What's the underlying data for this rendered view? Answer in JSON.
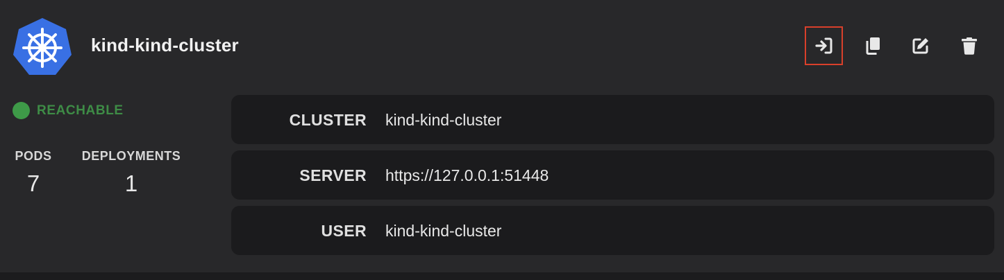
{
  "header": {
    "cluster_name": "kind-kind-cluster",
    "logo_icon": "kubernetes-helm-icon",
    "actions": [
      {
        "name": "connect",
        "icon": "sign-in-icon"
      },
      {
        "name": "copy",
        "icon": "copy-icon"
      },
      {
        "name": "edit",
        "icon": "edit-icon"
      },
      {
        "name": "delete",
        "icon": "trash-icon"
      }
    ]
  },
  "status": {
    "label": "REACHABLE",
    "color": "#3e9a48"
  },
  "stats": {
    "pods_label": "PODS",
    "pods_value": "7",
    "deployments_label": "DEPLOYMENTS",
    "deployments_value": "1"
  },
  "details": {
    "cluster_key": "CLUSTER",
    "cluster_value": "kind-kind-cluster",
    "server_key": "SERVER",
    "server_value": "https://127.0.0.1:51448",
    "user_key": "USER",
    "user_value": "kind-kind-cluster"
  },
  "colors": {
    "accent_highlight": "#d9402b",
    "kubernetes_blue": "#3970e4"
  }
}
